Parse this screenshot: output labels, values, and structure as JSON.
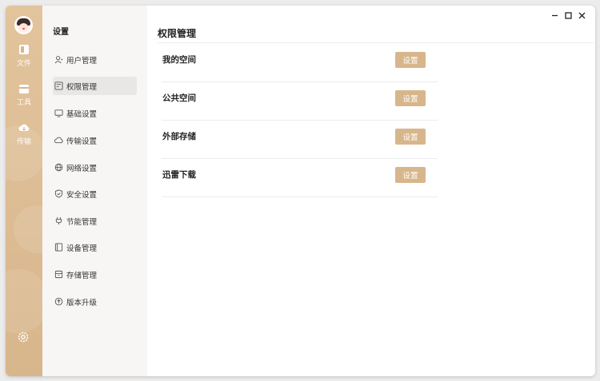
{
  "rail": {
    "items": [
      {
        "label": "文件",
        "icon": "file-icon"
      },
      {
        "label": "工具",
        "icon": "toolbox-icon"
      },
      {
        "label": "传输",
        "icon": "cloud-transfer-icon"
      }
    ],
    "bottom_icon": "gear-icon"
  },
  "sidebar": {
    "title": "设置",
    "items": [
      {
        "label": "用户管理",
        "icon": "user-icon"
      },
      {
        "label": "权限管理",
        "icon": "permission-icon",
        "active": true
      },
      {
        "label": "基础设置",
        "icon": "monitor-icon"
      },
      {
        "label": "传输设置",
        "icon": "cloud-icon"
      },
      {
        "label": "网络设置",
        "icon": "globe-icon"
      },
      {
        "label": "安全设置",
        "icon": "shield-icon"
      },
      {
        "label": "节能管理",
        "icon": "plug-icon"
      },
      {
        "label": "设备管理",
        "icon": "device-icon"
      },
      {
        "label": "存储管理",
        "icon": "storage-icon"
      },
      {
        "label": "版本升级",
        "icon": "upgrade-icon"
      }
    ]
  },
  "main": {
    "title": "权限管理",
    "rows": [
      {
        "label": "我的空间",
        "button": "设置"
      },
      {
        "label": "公共空间",
        "button": "设置"
      },
      {
        "label": "外部存储",
        "button": "设置"
      },
      {
        "label": "迅雷下载",
        "button": "设置"
      }
    ]
  },
  "window_controls": [
    "minimize-icon",
    "maximize-icon",
    "close-icon"
  ],
  "colors": {
    "accent": "#d8b68c",
    "rail_top": "#e2c49d",
    "sidebar_bg": "#f7f6f5",
    "active_item_bg": "#e9e7e5"
  }
}
